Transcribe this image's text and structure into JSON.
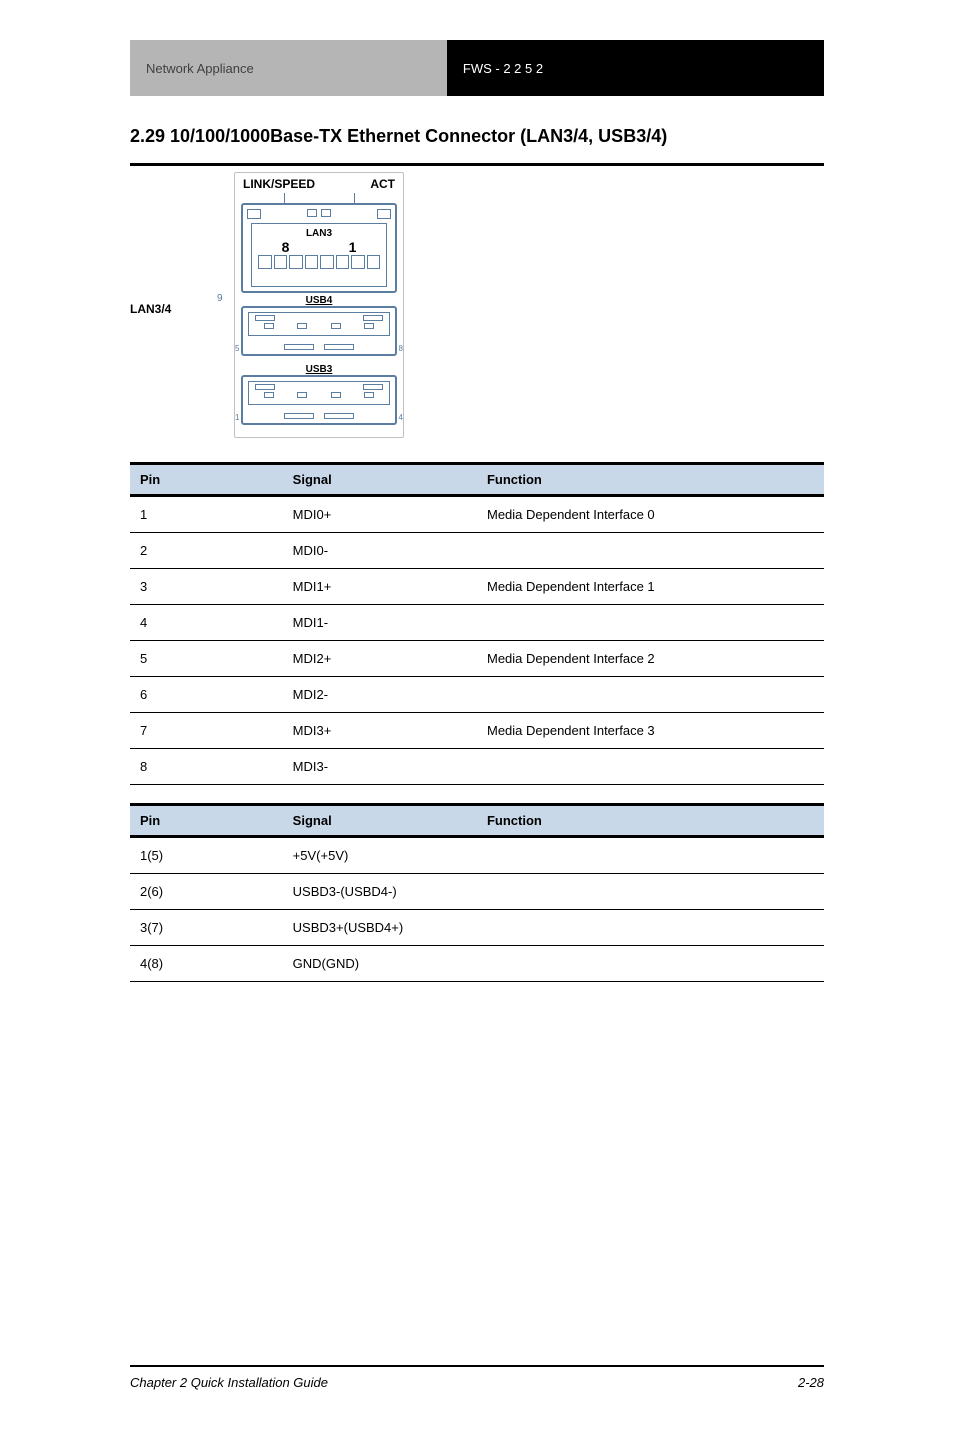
{
  "header": {
    "left": "Network Appliance",
    "right": "FWS - 2 2 5 2"
  },
  "title": "2.29 10/100/1000Base-TX Ethernet Connector (LAN3/4, USB3/4)",
  "diagram": {
    "id": "LAN3/4",
    "text_linkspeed": "LINK/SPEED",
    "text_act": "ACT",
    "rj45_label": "LAN3",
    "rj45_left": "8",
    "rj45_right": "1",
    "side": "9",
    "usb_top_label": "USB4",
    "usb_bottom_label": "USB3",
    "usb2_pins": {
      "l5": "5",
      "l8": "8"
    },
    "usb1_pins": {
      "l1": "1",
      "l4": "4"
    }
  },
  "tables": {
    "lan": {
      "header": {
        "pin": "Pin",
        "signal": "Signal",
        "function": "Function"
      },
      "rows": [
        {
          "pin": "1",
          "signal": "MDI0+",
          "function": "Media Dependent Interface 0"
        },
        {
          "pin": "2",
          "signal": "MDI0-",
          "function": ""
        },
        {
          "pin": "3",
          "signal": "MDI1+",
          "function": "Media Dependent Interface 1"
        },
        {
          "pin": "4",
          "signal": "MDI1-",
          "function": ""
        },
        {
          "pin": "5",
          "signal": "MDI2+",
          "function": "Media Dependent Interface 2"
        },
        {
          "pin": "6",
          "signal": "MDI2-",
          "function": ""
        },
        {
          "pin": "7",
          "signal": "MDI3+",
          "function": "Media Dependent Interface 3"
        },
        {
          "pin": "8",
          "signal": "MDI3-",
          "function": ""
        }
      ]
    },
    "usb": {
      "header": {
        "pin": "Pin",
        "signal": "Signal",
        "function": "Function"
      },
      "rows": [
        {
          "pin": "1(5)",
          "signal": "+5V(+5V)",
          "function": ""
        },
        {
          "pin": "2(6)",
          "signal": "USBD3-(USBD4-)",
          "function": ""
        },
        {
          "pin": "3(7)",
          "signal": "USBD3+(USBD4+)",
          "function": ""
        },
        {
          "pin": "4(8)",
          "signal": "GND(GND)",
          "function": ""
        }
      ]
    }
  },
  "footer": {
    "left": "Chapter 2 Quick Installation Guide",
    "right": "2-28"
  }
}
